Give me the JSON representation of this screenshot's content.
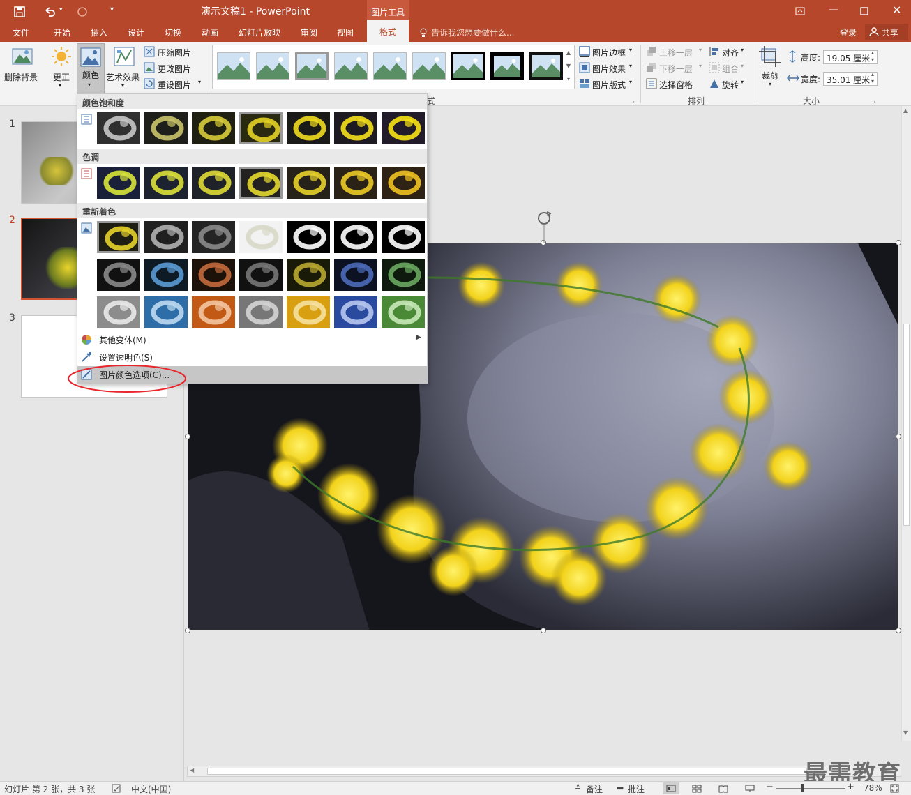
{
  "window": {
    "title": "演示文稿1 - PowerPoint",
    "tool_context": "图片工具",
    "login": "登录",
    "share": "共享"
  },
  "tabs": [
    "文件",
    "开始",
    "插入",
    "设计",
    "切换",
    "动画",
    "幻灯片放映",
    "审阅",
    "视图"
  ],
  "active_tab": "格式",
  "tell_me": "告诉我您想要做什么...",
  "ribbon": {
    "remove_bg": "删除背景",
    "corrections": "更正",
    "color": "颜色",
    "artistic": "艺术效果",
    "compress": "压缩图片",
    "change": "更改图片",
    "reset": "重设图片",
    "styles_group_tail": "式",
    "picture_border": "图片边框",
    "picture_effects": "图片效果",
    "picture_layout": "图片版式",
    "bring_forward": "上移一层",
    "send_backward": "下移一层",
    "selection_pane": "选择窗格",
    "align": "对齐",
    "group": "组合",
    "rotate": "旋转",
    "arrange_label": "排列",
    "crop": "裁剪",
    "height_label": "高度:",
    "height_value": "19.05 厘米",
    "width_label": "宽度:",
    "width_value": "35.01 厘米",
    "size_label": "大小"
  },
  "color_menu": {
    "saturation": "颜色饱和度",
    "tone": "色调",
    "recolor": "重新着色",
    "more_variations": "其他变体(M)",
    "set_transparent": "设置透明色(S)",
    "color_options": "图片颜色选项(C)..."
  },
  "slides": [
    "1",
    "2",
    "3"
  ],
  "status": {
    "slide_info": "幻灯片 第 2 张，共 3 张",
    "language": "中文(中国)",
    "notes": "备注",
    "comments": "批注",
    "zoom": "78%"
  },
  "watermark": "最需教育",
  "colors": {
    "accent": "#b7472a",
    "ribbon_bg": "#f3f3f3",
    "annotation": "#e8262b"
  }
}
